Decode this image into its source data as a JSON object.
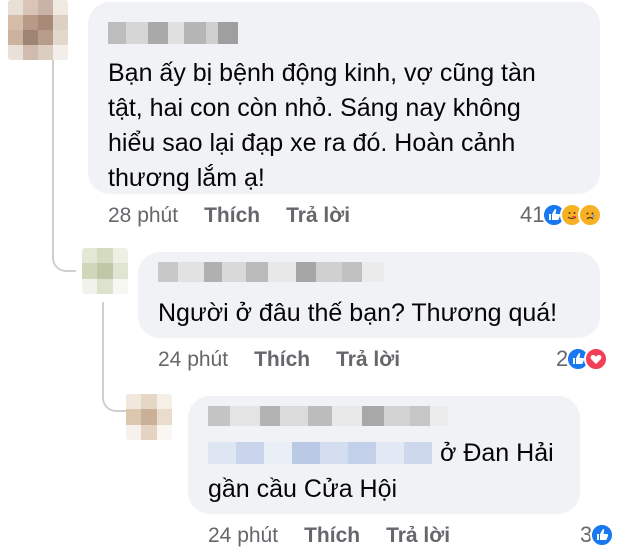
{
  "comments": [
    {
      "text": "Bạn ấy bị bệnh động kinh, vợ cũng tàn\ntật, hai con còn nhỏ. Sáng nay không\nhiểu sao lại đạp xe ra đó. Hoàn cảnh\nthương lắm ạ!",
      "time": "28 phút",
      "like_label": "Thích",
      "reply_label": "Trả lời",
      "reaction_count": "41",
      "reactions": [
        "like-icon",
        "care-icon",
        "sad-icon"
      ]
    },
    {
      "text": "Người ở đâu thế bạn? Thương quá!",
      "time": "24 phút",
      "like_label": "Thích",
      "reply_label": "Trả lời",
      "reaction_count": "2",
      "reactions": [
        "like-icon",
        "love-icon"
      ]
    },
    {
      "text_suffix": "ở Đan Hải",
      "text_line2": "gần cầu Cửa Hội",
      "time": "24 phút",
      "like_label": "Thích",
      "reply_label": "Trả lời",
      "reaction_count": "3",
      "reactions": [
        "like-icon"
      ]
    }
  ],
  "colors": {
    "bubble": "#f0f2f5",
    "meta_text": "#65676b",
    "like_blue": "#1877f2",
    "love_red": "#f33e58",
    "care_yellow": "#f7b125"
  }
}
